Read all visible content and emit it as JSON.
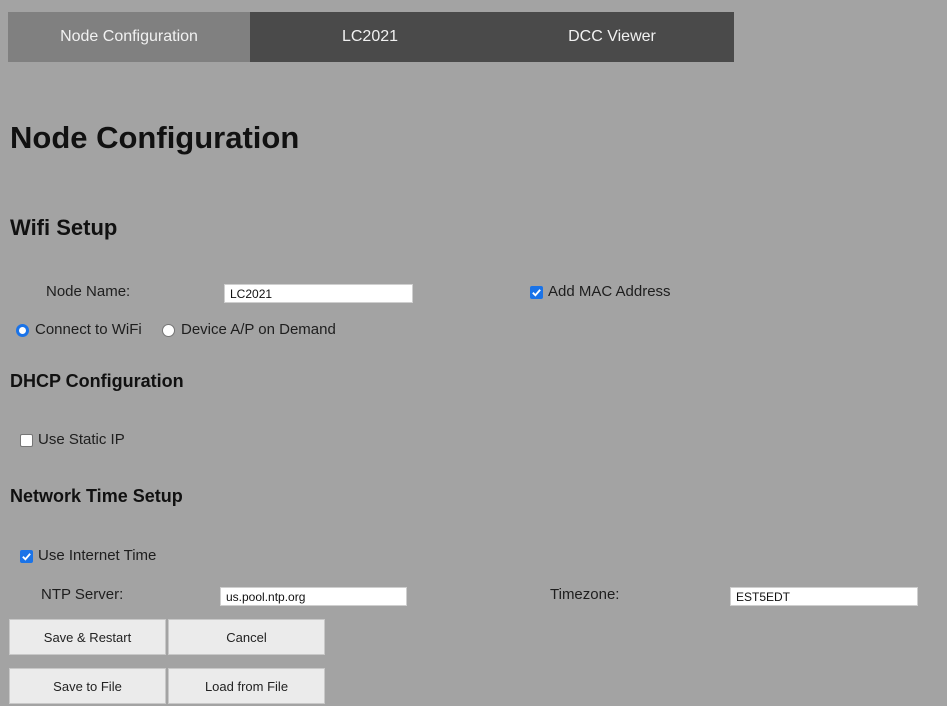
{
  "tabs": [
    {
      "label": "Node Configuration",
      "active": true
    },
    {
      "label": "LC2021",
      "active": false
    },
    {
      "label": "DCC Viewer",
      "active": false
    }
  ],
  "page_title": "Node Configuration",
  "wifi": {
    "title": "Wifi Setup",
    "node_name_label": "Node Name:",
    "node_name_value": "LC2021",
    "add_mac_label": "Add MAC Address",
    "add_mac_checked": true,
    "connect_wifi_label": "Connect to WiFi",
    "device_ap_label": "Device A/P on Demand",
    "selected_mode": "connect_wifi"
  },
  "dhcp": {
    "title": "DHCP Configuration",
    "static_ip_label": "Use Static IP",
    "static_ip_checked": false
  },
  "ntp": {
    "title": "Network Time Setup",
    "use_internet_time_label": "Use Internet Time",
    "use_internet_time_checked": true,
    "ntp_server_label": "NTP Server:",
    "ntp_server_value": "us.pool.ntp.org",
    "timezone_label": "Timezone:",
    "timezone_value": "EST5EDT"
  },
  "buttons": {
    "save_restart": "Save & Restart",
    "cancel": "Cancel",
    "save_file": "Save to File",
    "load_file": "Load from File"
  },
  "colors": {
    "background": "#a3a3a3",
    "tab_bar": "#4a4a4a",
    "tab_active": "#808080",
    "checkbox_accent": "#1a73e8"
  }
}
